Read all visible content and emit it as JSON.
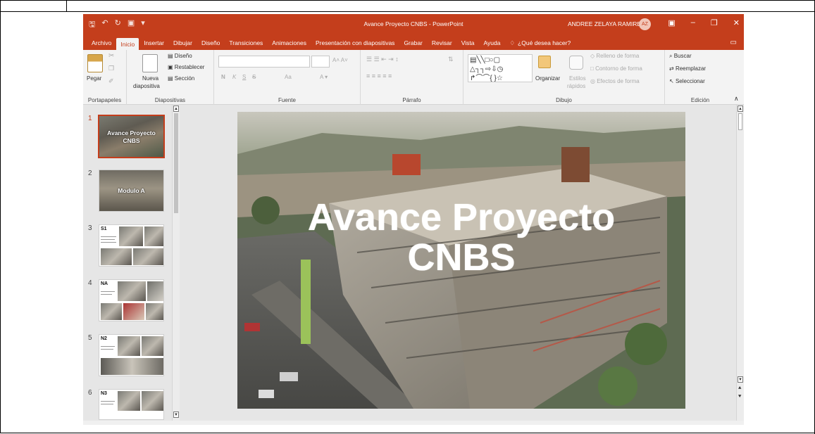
{
  "window": {
    "doc_title": "Avance Proyecto CNBS - PowerPoint",
    "user_name": "ANDREE ZELAYA RAMIREZ",
    "user_initials": "AZ",
    "accent": "#c43e1c"
  },
  "tabs": [
    "Archivo",
    "Inicio",
    "Insertar",
    "Dibujar",
    "Diseño",
    "Transiciones",
    "Animaciones",
    "Presentación con diapositivas",
    "Grabar",
    "Revisar",
    "Vista",
    "Ayuda"
  ],
  "tell_me": "¿Qué desea hacer?",
  "ribbon": {
    "portapapeles": {
      "label": "Portapapeles",
      "paste": "Pegar"
    },
    "diapositivas": {
      "label": "Diapositivas",
      "new_slide_1": "Nueva",
      "new_slide_2": "diapositiva",
      "layout": "Diseño",
      "reset": "Restablecer",
      "section": "Sección"
    },
    "fuente": {
      "label": "Fuente",
      "bold": "N",
      "italic": "K",
      "underline": "S",
      "strike": "S",
      "aa": "Aa"
    },
    "parrafo": {
      "label": "Párrafo"
    },
    "dibujo": {
      "label": "Dibujo",
      "arrange": "Organizar",
      "styles_1": "Estilos",
      "styles_2": "rápidos",
      "fill": "Relleno de forma",
      "outline": "Contorno de forma",
      "effects": "Efectos de forma"
    },
    "edicion": {
      "label": "Edición",
      "find": "Buscar",
      "replace": "Reemplazar",
      "select": "Seleccionar"
    }
  },
  "thumbnails": [
    {
      "num": "1",
      "title": "Avance Proyecto CNBS",
      "kind": "photo"
    },
    {
      "num": "2",
      "title": "Modulo A",
      "kind": "photo"
    },
    {
      "num": "3",
      "title": "S1",
      "kind": "doc"
    },
    {
      "num": "4",
      "title": "NA",
      "kind": "doc"
    },
    {
      "num": "5",
      "title": "N2",
      "kind": "doc"
    },
    {
      "num": "6",
      "title": "N3",
      "kind": "doc"
    }
  ],
  "slide": {
    "title_line1": "Avance Proyecto",
    "title_line2": "CNBS"
  }
}
